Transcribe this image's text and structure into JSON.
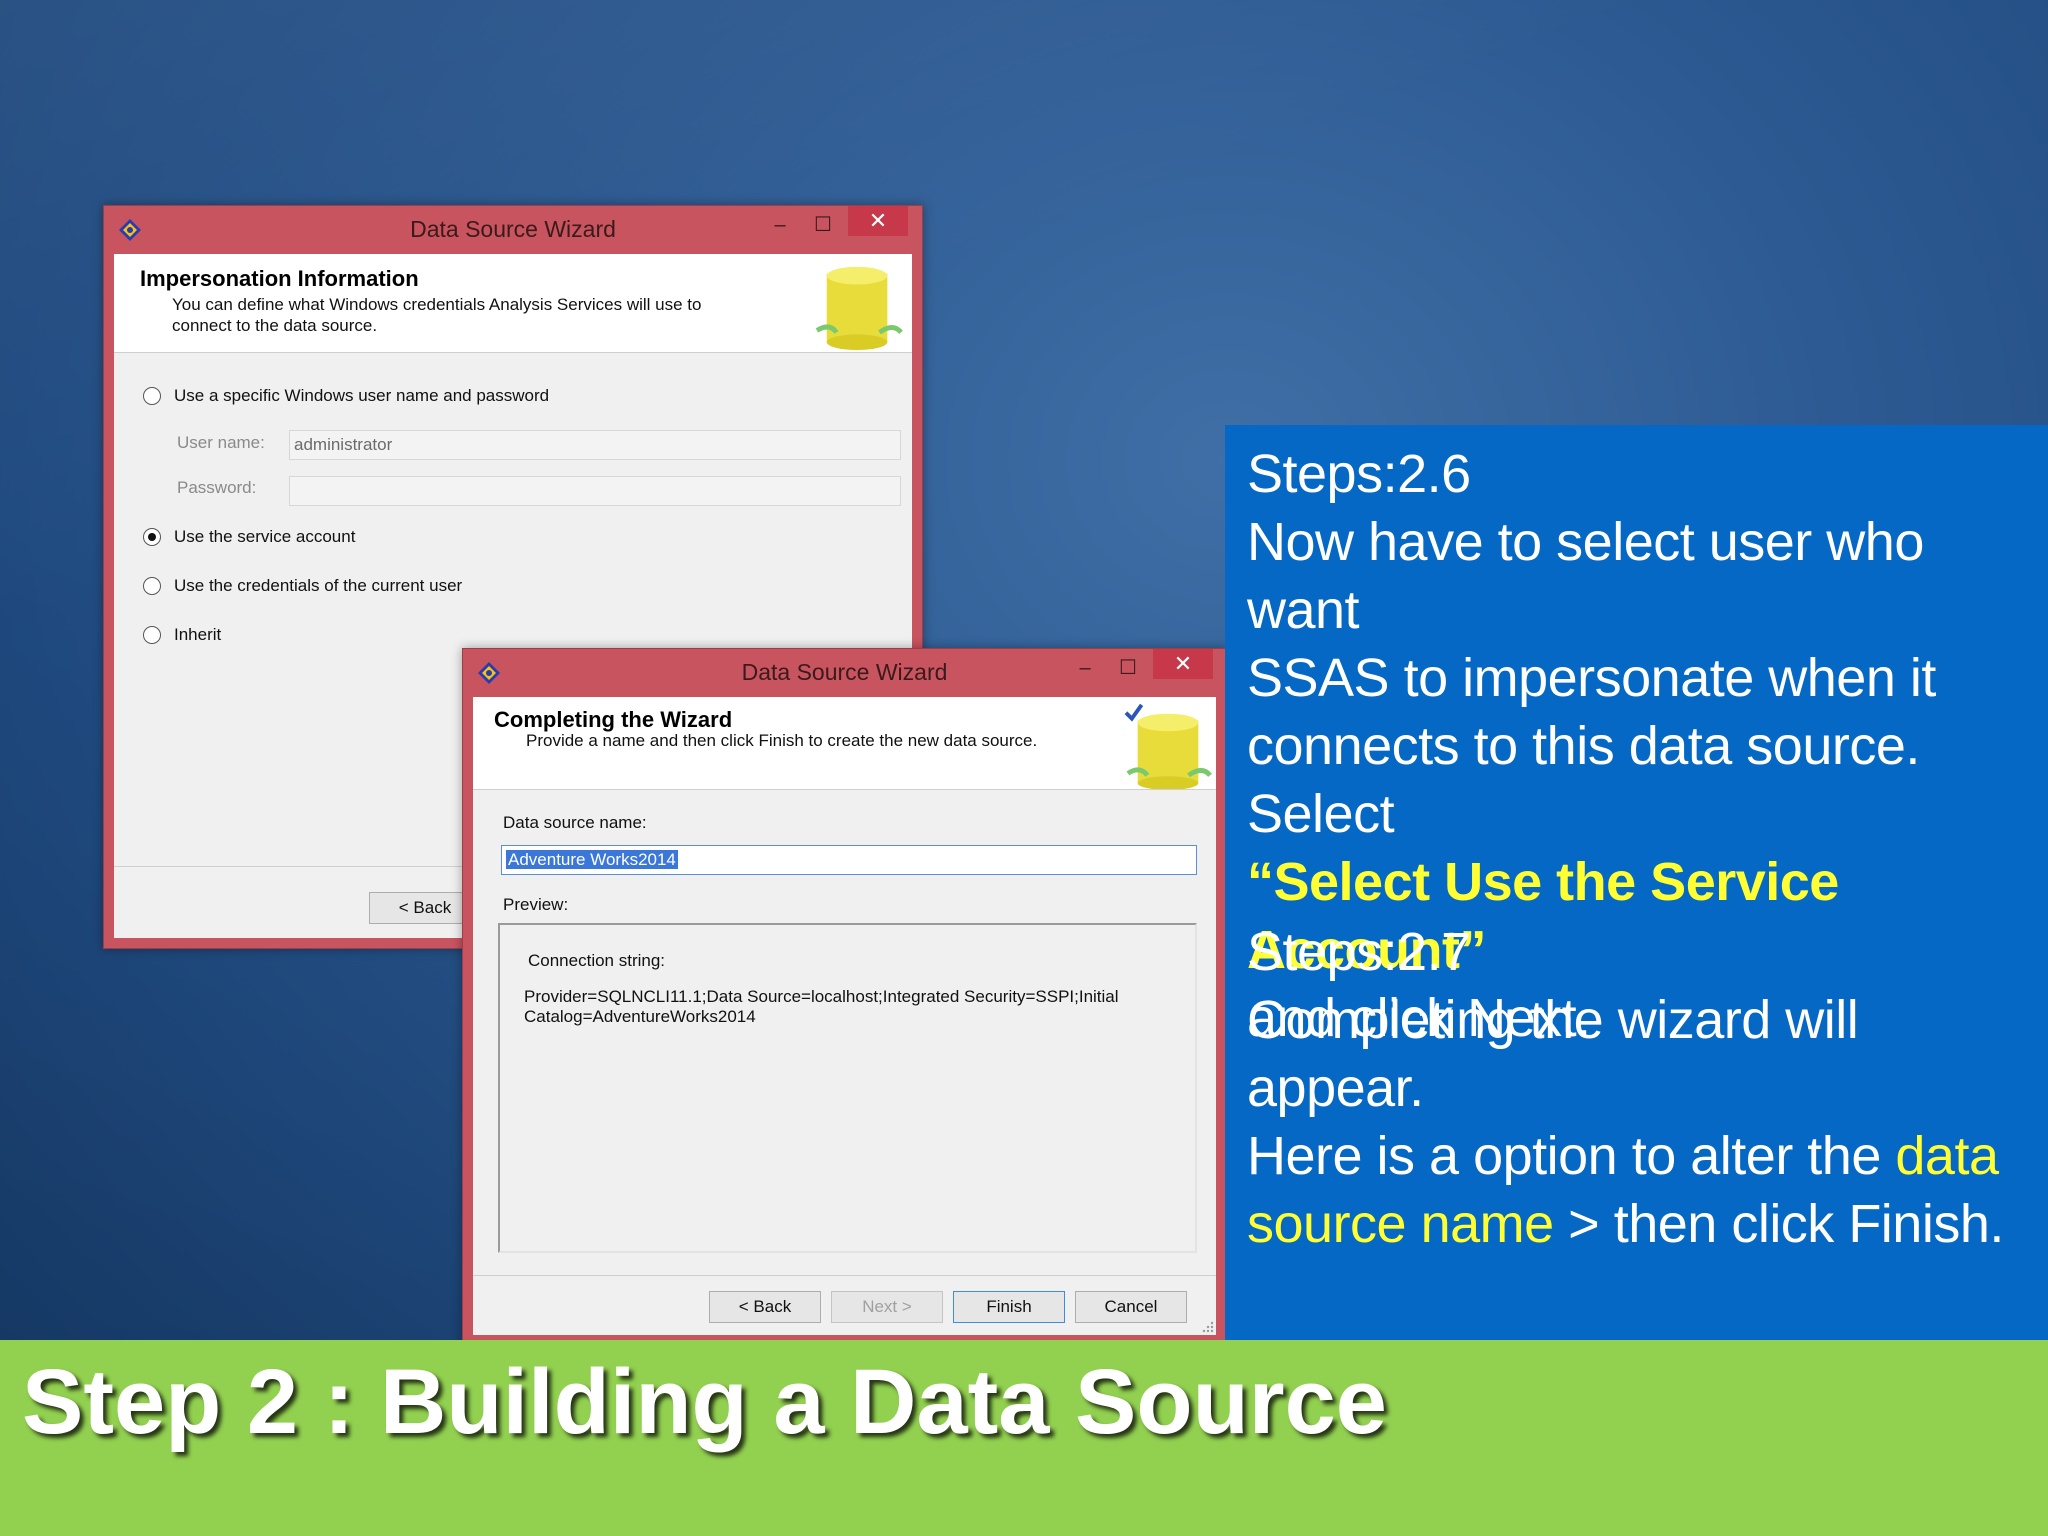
{
  "dialog_back": {
    "title": "Data Source Wizard",
    "minimize": "–",
    "maximize": "☐",
    "close": "✕",
    "header_title": "Impersonation Information",
    "header_sub_line1": "You can define what Windows credentials Analysis Services will use to",
    "header_sub_line2": "connect to the data source.",
    "options": [
      {
        "label": "Use a specific Windows user name and password",
        "selected": false
      },
      {
        "label": "Use the service account",
        "selected": true
      },
      {
        "label": "Use the credentials of the current user",
        "selected": false
      },
      {
        "label": "Inherit",
        "selected": false
      }
    ],
    "username_label": "User name:",
    "username_value": "administrator",
    "password_label": "Password:",
    "password_value": "",
    "back_button": "< Back"
  },
  "dialog_front": {
    "title": "Data Source Wizard",
    "minimize": "–",
    "maximize": "☐",
    "close": "✕",
    "header_title": "Completing the Wizard",
    "header_sub": "Provide a name and then click Finish to create the new data source.",
    "ds_name_label": "Data source name:",
    "ds_name_value": "Adventure Works2014",
    "preview_label": "Preview:",
    "conn_label": "Connection string:",
    "conn_line1": "Provider=SQLNCLI11.1;Data Source=localhost;Integrated Security=SSPI;Initial",
    "conn_line2": "Catalog=AdventureWorks2014",
    "buttons": {
      "back": "< Back",
      "next": "Next >",
      "finish": "Finish",
      "cancel": "Cancel"
    }
  },
  "panel": {
    "step1_heading": "Steps:2.6",
    "step1_line1": "Now have to select user who want",
    "step1_line2": "SSAS to impersonate when it",
    "step1_line3": "connects to this data source. Select",
    "step1_highlight": "“Select Use the Service Account”",
    "step1_line5": "and click Next.",
    "step2_heading": "Steps:2.7",
    "step2_line1": "Completing the wizard will appear.",
    "step2_line2_pre": "Here is a option to alter the ",
    "step2_line2_hl": "data",
    "step2_line3_hl": "source name",
    "step2_line3_post": " > then click Finish."
  },
  "footer": {
    "title": "Step 2 : Building a Data Source"
  },
  "colors": {
    "panel_blue": "#0468c4",
    "footer_green": "#92d050",
    "highlight_yellow": "#ffff33",
    "titlebar_red": "#c8545f"
  }
}
